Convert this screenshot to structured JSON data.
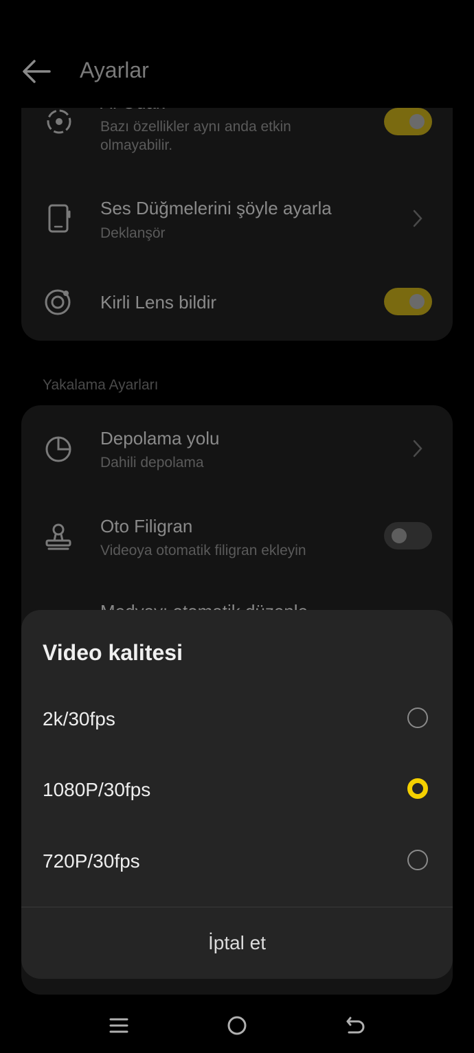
{
  "header": {
    "title": "Ayarlar"
  },
  "card1": {
    "rows": [
      {
        "title": "AI Odak",
        "subtitle": "Bazı özellikler aynı anda etkin olmayabilir.",
        "toggle": "on"
      },
      {
        "title": "Ses Düğmelerini şöyle ayarla",
        "subtitle": "Deklanşör"
      },
      {
        "title": "Kirli Lens bildir",
        "toggle": "on"
      }
    ]
  },
  "section": {
    "label": "Yakalama Ayarları"
  },
  "card2": {
    "rows": [
      {
        "title": "Depolama yolu",
        "subtitle": "Dahili depolama"
      },
      {
        "title": "Oto Filigran",
        "subtitle": "Videoya otomatik filigran ekleyin",
        "toggle": "off"
      },
      {
        "title": "Medyayı otomatik düzenle"
      }
    ]
  },
  "modal": {
    "title": "Video kalitesi",
    "options": [
      {
        "label": "2k/30fps",
        "selected": false
      },
      {
        "label": "1080P/30fps",
        "selected": true
      },
      {
        "label": "720P/30fps",
        "selected": false
      }
    ],
    "cancel": "İptal et"
  },
  "colors": {
    "accent": "#f4d000",
    "modal_bg": "#252525"
  },
  "nav": {
    "icons": [
      "menu-icon",
      "home-icon",
      "back-nav-icon"
    ]
  }
}
